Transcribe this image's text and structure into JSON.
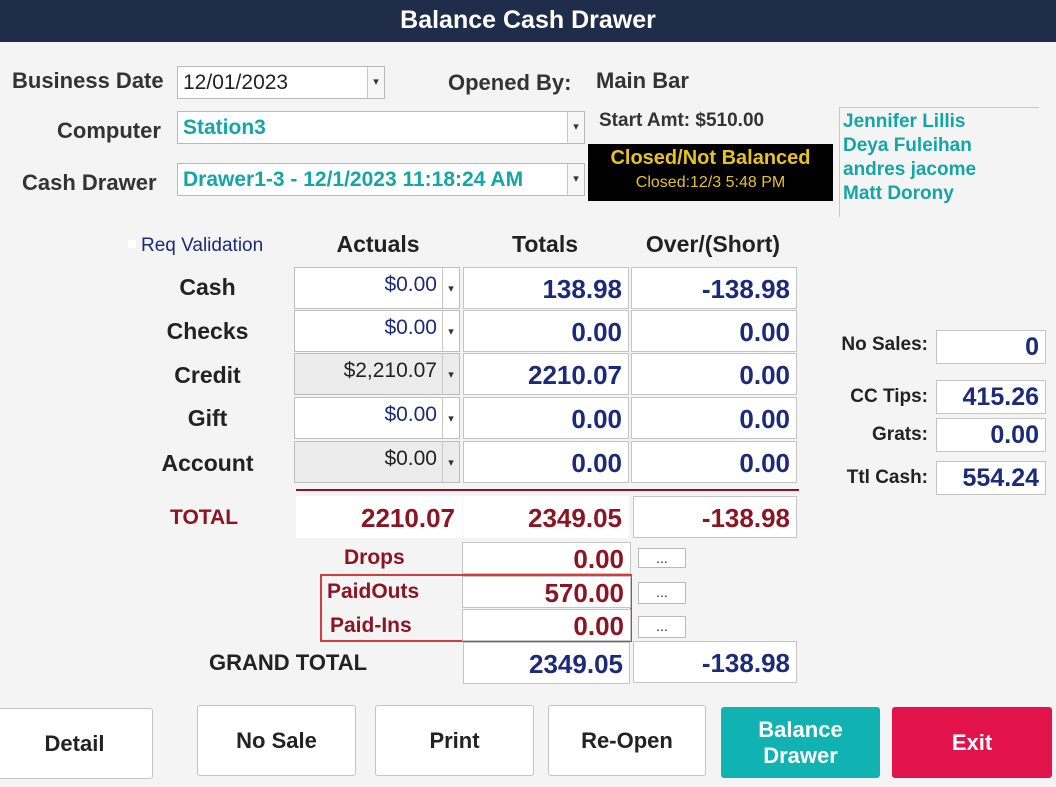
{
  "window": {
    "title": "Balance Cash Drawer"
  },
  "header": {
    "business_date_label": "Business Date",
    "business_date_value": "12/01/2023",
    "computer_label": "Computer",
    "computer_value": "Station3",
    "cash_drawer_label": "Cash Drawer",
    "cash_drawer_value": "Drawer1-3 - 12/1/2023 11:18:24 AM",
    "opened_by_label": "Opened By:",
    "opened_by_value": "Main Bar",
    "start_amt": "Start Amt: $510.00",
    "status_main": "Closed/Not Balanced",
    "status_sub": "Closed:12/3 5:48 PM",
    "users": [
      "Jennifer Lillis",
      "Deya Fuleihan",
      "andres jacome",
      "Matt Dorony"
    ]
  },
  "grid": {
    "req_validation_label": "Req Validation",
    "columns": [
      "Actuals",
      "Totals",
      "Over/(Short)"
    ],
    "rows": [
      {
        "label": "Cash",
        "actual": "$0.00",
        "total": "138.98",
        "over": "-138.98"
      },
      {
        "label": "Checks",
        "actual": "$0.00",
        "total": "0.00",
        "over": "0.00"
      },
      {
        "label": "Credit",
        "actual": "$2,210.07",
        "total": "2210.07",
        "over": "0.00"
      },
      {
        "label": "Gift",
        "actual": "$0.00",
        "total": "0.00",
        "over": "0.00"
      },
      {
        "label": "Account",
        "actual": "$0.00",
        "total": "0.00",
        "over": "0.00"
      }
    ],
    "total_label": "TOTAL",
    "total_actual": "2210.07",
    "total_total": "2349.05",
    "total_over": "-138.98",
    "drops_label": "Drops",
    "drops_value": "0.00",
    "paidouts_label": "PaidOuts",
    "paidouts_value": "570.00",
    "paidins_label": "Paid-Ins",
    "paidins_value": "0.00",
    "dots_label": "...",
    "grand_total_label": "GRAND TOTAL",
    "grand_total_total": "2349.05",
    "grand_total_over": "-138.98"
  },
  "side": {
    "no_sales_label": "No Sales:",
    "no_sales_value": "0",
    "cc_tips_label": "CC Tips:",
    "cc_tips_value": "415.26",
    "grats_label": "Grats:",
    "grats_value": "0.00",
    "ttl_cash_label": "Ttl Cash:",
    "ttl_cash_value": "554.24"
  },
  "buttons": {
    "detail": "Detail",
    "no_sale": "No Sale",
    "print": "Print",
    "reopen": "Re-Open",
    "balance_drawer": "Balance Drawer",
    "exit": "Exit"
  },
  "colors": {
    "title_bar": "#1f2d4a",
    "teal_text": "#14a6a6",
    "navy_value": "#1c2a7a",
    "maroon": "#8b1522",
    "balance_button": "#10b3b1",
    "exit_button": "#e2124a",
    "status_text": "#e8c31c"
  }
}
